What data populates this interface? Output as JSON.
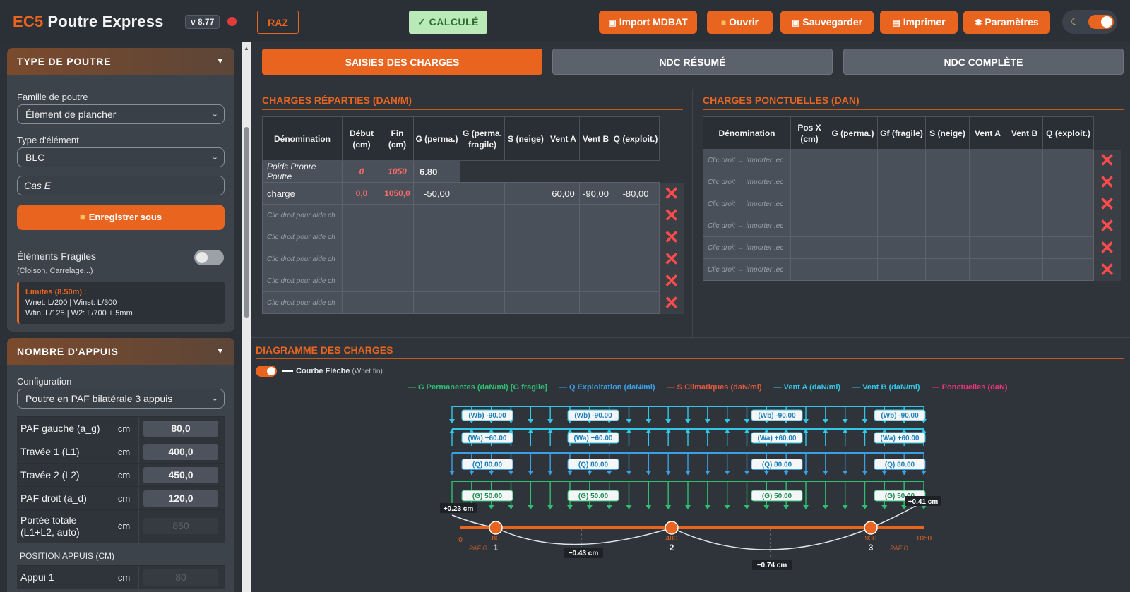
{
  "header": {
    "brand": "EC5",
    "title": "Poutre Express",
    "version": "v 8.77",
    "raz": "RAZ",
    "calc": "✓ CALCULÉ",
    "buttons": [
      {
        "label": "Import MDBAT",
        "icon": "database-icon"
      },
      {
        "label": "Ouvrir",
        "icon": "folder-icon"
      },
      {
        "label": "Sauvegarder",
        "icon": "floppy-icon"
      },
      {
        "label": "Imprimer",
        "icon": "printer-icon"
      },
      {
        "label": "Paramètres",
        "icon": "gear-icon"
      }
    ]
  },
  "sidebar": {
    "type_panel": {
      "title": "TYPE DE POUTRE",
      "famille_label": "Famille de poutre",
      "famille_value": "Élément de plancher",
      "type_label": "Type d'élément",
      "type_value": "BLC",
      "cas_value": "Cas E",
      "save_as": "Enregistrer sous",
      "fragiles_label": "Éléments Fragiles",
      "fragiles_sub": "(Cloison, Carrelage...)",
      "limits_title": "Limites (8.50m) :",
      "limits_line1": "Wnet: L/200 | Winst: L/300",
      "limits_line2": "Wfin: L/125 | W2: L/700 + 5mm"
    },
    "appuis_panel": {
      "title": "NOMBRE D'APPUIS",
      "config_label": "Configuration",
      "config_value": "Poutre en PAF bilatérale 3 appuis",
      "rows": [
        {
          "label": "PAF gauche (a_g)",
          "unit": "cm",
          "value": "80,0"
        },
        {
          "label": "Travée 1 (L1)",
          "unit": "cm",
          "value": "400,0"
        },
        {
          "label": "Travée 2 (L2)",
          "unit": "cm",
          "value": "450,0"
        },
        {
          "label": "PAF droit (a_d)",
          "unit": "cm",
          "value": "120,0"
        }
      ],
      "portee_label1": "Portée totale",
      "portee_label2": "(L1+L2, auto)",
      "portee_unit": "cm",
      "portee_value": "850",
      "position_title": "POSITION APPUIS (CM)",
      "appui1_label": "Appui 1",
      "appui1_unit": "cm",
      "appui1_value": "80"
    }
  },
  "tabs": [
    "SAISIES DES CHARGES",
    "NDC RÉSUMÉ",
    "NDC COMPLÈTE"
  ],
  "reparties": {
    "title": "CHARGES RÉPARTIES (DAN/M)",
    "headers": [
      "Dénomination",
      "Début (cm)",
      "Fin (cm)",
      "G (perma.)",
      "G (perma. fragile)",
      "S (neige)",
      "Vent A",
      "Vent B",
      "Q (exploit.)"
    ],
    "pp": {
      "name": "Poids Propre Poutre",
      "debut": "0",
      "fin": "1050",
      "g": "6.80"
    },
    "charge": {
      "name": "charge",
      "debut": "0,0",
      "fin": "1050,0",
      "g": "-50,00",
      "ga": "60,00",
      "vb": "-90,00",
      "q": "-80,00"
    },
    "placeholder": "Clic droit pour aide ch"
  },
  "ponctuelles": {
    "title": "CHARGES PONCTUELLES (DAN)",
    "headers": [
      "Dénomination",
      "Pos X (cm)",
      "G (perma.)",
      "Gf (fragile)",
      "S (neige)",
      "Vent A",
      "Vent B",
      "Q (exploit.)"
    ],
    "placeholder": "Clic droit → importer .ec"
  },
  "diagram": {
    "title": "DIAGRAMME DES CHARGES",
    "courbe": "Courbe Flèche",
    "courbe_sub": "(Wnet fin)",
    "legend": [
      {
        "label": "— G Permanentes (daN/ml) [G fragile]",
        "color": "#2fbf71"
      },
      {
        "label": "— Q Exploitation (daN/ml)",
        "color": "#3aa0e6"
      },
      {
        "label": "— S Climatiques (daN/ml)",
        "color": "#e0583a"
      },
      {
        "label": "— Vent A (daN/ml)",
        "color": "#34c6e6"
      },
      {
        "label": "— Vent B (daN/ml)",
        "color": "#34c6e6"
      },
      {
        "label": "— Ponctuelles (daN)",
        "color": "#e6357a"
      }
    ],
    "wb_label": "(Wb) -90.00",
    "wa_label": "(Wa) +60.00",
    "q_label": "(Q) 80.00",
    "g_label": "(G) 50.00",
    "defl_left": "+0.23 cm",
    "defl_right": "+0.41 cm",
    "defl_span1": "−0.43 cm",
    "defl_span2": "−0.74 cm",
    "x_ticks": [
      "0",
      "80",
      "480",
      "930",
      "1050"
    ],
    "supports": [
      "1",
      "2",
      "3"
    ],
    "paf_g": "PAF G",
    "paf_d": "PAF D"
  }
}
